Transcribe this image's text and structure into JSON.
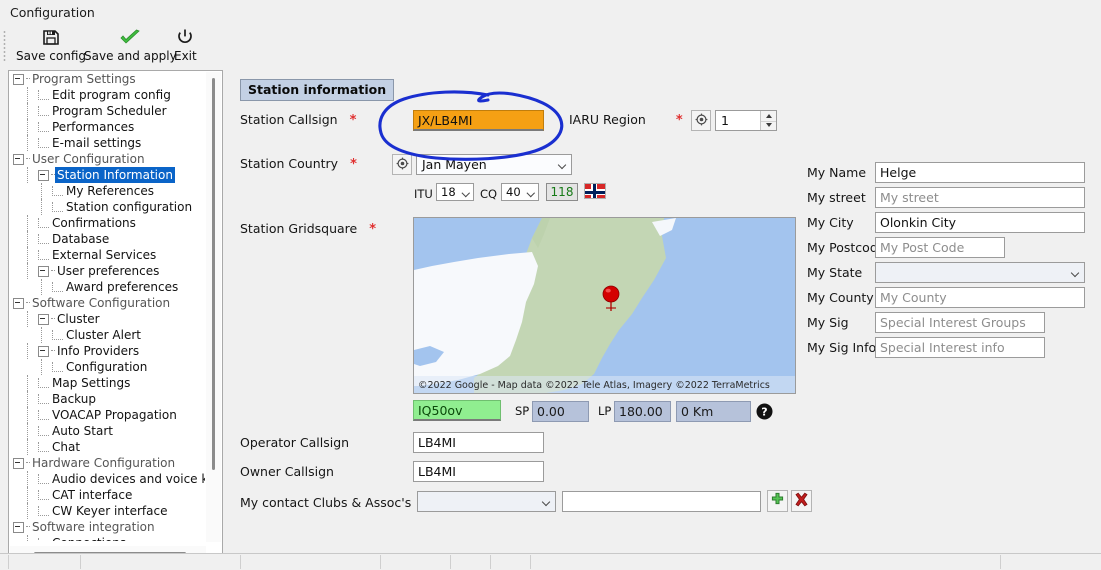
{
  "window": {
    "title": "Configuration"
  },
  "toolbar": {
    "buttons": [
      {
        "label": "Save config",
        "icon": "floppy-disk-icon"
      },
      {
        "label": "Save and apply",
        "icon": "green-check-icon"
      },
      {
        "label": "Exit",
        "icon": "power-icon"
      }
    ]
  },
  "sidebar": {
    "items": [
      {
        "label": "Program Settings",
        "depth": 0,
        "expander": true,
        "style": "grey"
      },
      {
        "label": "Edit program config",
        "depth": 1,
        "expander": false,
        "style": "normal"
      },
      {
        "label": "Program Scheduler",
        "depth": 1,
        "expander": false,
        "style": "normal"
      },
      {
        "label": "Performances",
        "depth": 1,
        "expander": false,
        "style": "normal"
      },
      {
        "label": "E-mail settings",
        "depth": 1,
        "expander": false,
        "style": "normal"
      },
      {
        "label": "User Configuration",
        "depth": 0,
        "expander": true,
        "style": "grey"
      },
      {
        "label": "Station Information",
        "depth": 1,
        "expander": true,
        "style": "selected"
      },
      {
        "label": "My References",
        "depth": 2,
        "expander": false,
        "style": "normal"
      },
      {
        "label": "Station configuration",
        "depth": 2,
        "expander": false,
        "style": "normal"
      },
      {
        "label": "Confirmations",
        "depth": 1,
        "expander": false,
        "style": "normal"
      },
      {
        "label": "Database",
        "depth": 1,
        "expander": false,
        "style": "normal"
      },
      {
        "label": "External Services",
        "depth": 1,
        "expander": false,
        "style": "normal"
      },
      {
        "label": "User preferences",
        "depth": 1,
        "expander": true,
        "style": "normal"
      },
      {
        "label": "Award preferences",
        "depth": 2,
        "expander": false,
        "style": "normal"
      },
      {
        "label": "Software Configuration",
        "depth": 0,
        "expander": true,
        "style": "grey"
      },
      {
        "label": "Cluster",
        "depth": 1,
        "expander": true,
        "style": "normal"
      },
      {
        "label": "Cluster Alert",
        "depth": 2,
        "expander": false,
        "style": "normal"
      },
      {
        "label": "Info Providers",
        "depth": 1,
        "expander": true,
        "style": "normal"
      },
      {
        "label": "Configuration",
        "depth": 2,
        "expander": false,
        "style": "normal"
      },
      {
        "label": "Map Settings",
        "depth": 1,
        "expander": false,
        "style": "normal"
      },
      {
        "label": "Backup",
        "depth": 1,
        "expander": false,
        "style": "normal"
      },
      {
        "label": "VOACAP Propagation",
        "depth": 1,
        "expander": false,
        "style": "normal"
      },
      {
        "label": "Auto Start",
        "depth": 1,
        "expander": false,
        "style": "normal"
      },
      {
        "label": "Chat",
        "depth": 1,
        "expander": false,
        "style": "normal"
      },
      {
        "label": "Hardware Configuration",
        "depth": 0,
        "expander": true,
        "style": "grey"
      },
      {
        "label": "Audio devices and voice keye",
        "depth": 1,
        "expander": false,
        "style": "normal"
      },
      {
        "label": "CAT interface",
        "depth": 1,
        "expander": false,
        "style": "normal"
      },
      {
        "label": "CW Keyer interface",
        "depth": 1,
        "expander": false,
        "style": "normal"
      },
      {
        "label": "Software integration",
        "depth": 0,
        "expander": true,
        "style": "grey"
      },
      {
        "label": "Connections",
        "depth": 1,
        "expander": false,
        "style": "normal"
      }
    ]
  },
  "main": {
    "section_title": "Station information",
    "fields": {
      "station_callsign": {
        "label": "Station Callsign",
        "required": "*",
        "value": "JX/LB4MI"
      },
      "iaru_region": {
        "label": "IARU Region",
        "required": "*",
        "value": "1",
        "locate_icon": "target-icon"
      },
      "station_country": {
        "label": "Station Country",
        "required": "*",
        "value": "Jan Mayen",
        "locate_icon": "target-icon"
      },
      "itu": {
        "label": "ITU",
        "value": "18"
      },
      "cq": {
        "label": "CQ",
        "value": "40"
      },
      "dxcc": {
        "value": "118"
      },
      "flag": {
        "name": "norway-flag-icon"
      },
      "station_gridsquare": {
        "label": "Station Gridsquare",
        "required": "*",
        "value": "IQ50ov"
      },
      "short_path": {
        "label": "SP",
        "value": "0.00"
      },
      "long_path": {
        "label": "LP",
        "value": "180.00"
      },
      "distance": {
        "value": "0 Km"
      },
      "help": {
        "icon": "help-icon"
      },
      "operator_callsign": {
        "label": "Operator Callsign",
        "value": "LB4MI"
      },
      "owner_callsign": {
        "label": "Owner Callsign",
        "value": "LB4MI"
      },
      "clubs": {
        "label": "My contact Clubs & Assoc's",
        "select_value": "",
        "text_value": "",
        "add_icon": "plus-icon",
        "delete_icon": "delete-x-icon"
      }
    },
    "right_fields": [
      {
        "label": "My Name",
        "value": "Helge",
        "placeholder": "",
        "type": "text"
      },
      {
        "label": "My street",
        "value": "",
        "placeholder": "My street",
        "type": "text"
      },
      {
        "label": "My City",
        "value": "Olonkin City",
        "placeholder": "",
        "type": "text"
      },
      {
        "label": "My Postcode",
        "value": "",
        "placeholder": "My Post Code",
        "type": "text"
      },
      {
        "label": "My State",
        "value": "",
        "placeholder": "",
        "type": "select"
      },
      {
        "label": "My County",
        "value": "",
        "placeholder": "My County",
        "type": "text"
      },
      {
        "label": "My Sig",
        "value": "",
        "placeholder": "Special Interest Groups",
        "type": "text"
      },
      {
        "label": "My Sig Info",
        "value": "",
        "placeholder": "Special Interest info",
        "type": "text"
      }
    ],
    "map": {
      "attribution": "©2022 Google - Map data ©2022 Tele Atlas, Imagery ©2022 TerraMetrics",
      "marker": "map-pin-marker"
    },
    "annotation": {
      "name": "blue-circle-annotation",
      "color": "#1a2fd0"
    }
  },
  "colors": {
    "highlight_orange": "#f5a014",
    "highlight_green": "#90ee90",
    "selection_blue": "#0a64c8",
    "annotation_blue": "#1a2fd0",
    "required_red": "#e03030",
    "map_water": "#a3c4ee",
    "map_land": "#c3d6b4"
  }
}
